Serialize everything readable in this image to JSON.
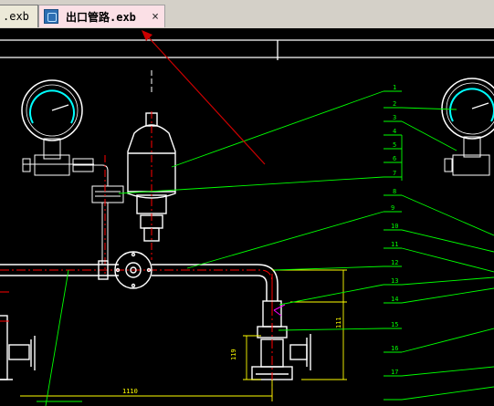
{
  "tabs": [
    {
      "label": ".exb",
      "active": false
    },
    {
      "label": "出口管路.exb",
      "active": true
    }
  ],
  "tab_close_symbol": "×",
  "tab_icon": "document-app-icon",
  "drawing": {
    "balloons": [
      "1",
      "2",
      "3",
      "4",
      "5",
      "6",
      "7",
      "8",
      "9",
      "10",
      "11",
      "12",
      "13",
      "14",
      "15",
      "16",
      "17"
    ],
    "dim_1110": "1110",
    "dim_119": "119",
    "dim_111": "111"
  },
  "colors": {
    "background": "#000000",
    "line_white": "#ffffff",
    "leader_green": "#00ff00",
    "dimension_yellow": "#ffff00",
    "pipe_red": "#ff0000",
    "annotation_arrow": "#cc0000",
    "gauge_cyan": "#00ffff"
  }
}
